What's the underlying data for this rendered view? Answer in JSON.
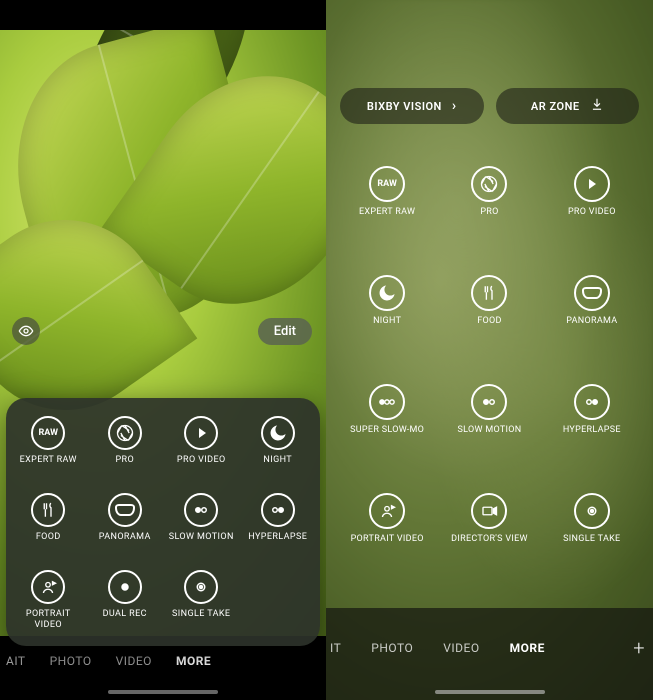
{
  "left": {
    "edit_label": "Edit",
    "modes": [
      {
        "icon": "RAW",
        "label": "EXPERT RAW"
      },
      {
        "icon": "aperture",
        "label": "PRO"
      },
      {
        "icon": "play",
        "label": "PRO VIDEO"
      },
      {
        "icon": "moon",
        "label": "NIGHT"
      },
      {
        "icon": "food",
        "label": "FOOD"
      },
      {
        "icon": "panorama",
        "label": "PANORAMA"
      },
      {
        "icon": "slowmo",
        "label": "SLOW MOTION"
      },
      {
        "icon": "hyperlapse",
        "label": "HYPERLAPSE"
      },
      {
        "icon": "portraitvid",
        "label": "PORTRAIT VIDEO"
      },
      {
        "icon": "dualrec",
        "label": "DUAL REC"
      },
      {
        "icon": "singletake",
        "label": "SINGLE TAKE"
      }
    ],
    "tabs": {
      "portrait": "AIT",
      "photo": "PHOTO",
      "video": "VIDEO",
      "more": "MORE"
    },
    "active_tab": "more"
  },
  "right": {
    "pills": {
      "bixby": "BIXBY VISION",
      "arzone": "AR ZONE"
    },
    "modes": [
      {
        "icon": "RAW",
        "label": "EXPERT RAW"
      },
      {
        "icon": "aperture",
        "label": "PRO"
      },
      {
        "icon": "play",
        "label": "PRO VIDEO"
      },
      {
        "icon": "moon",
        "label": "NIGHT"
      },
      {
        "icon": "food",
        "label": "FOOD"
      },
      {
        "icon": "panorama",
        "label": "PANORAMA"
      },
      {
        "icon": "superslow",
        "label": "SUPER SLOW-MO"
      },
      {
        "icon": "slowmo",
        "label": "SLOW MOTION"
      },
      {
        "icon": "hyperlapse",
        "label": "HYPERLAPSE"
      },
      {
        "icon": "portraitvid",
        "label": "PORTRAIT VIDEO"
      },
      {
        "icon": "director",
        "label": "DIRECTOR'S VIEW"
      },
      {
        "icon": "singletake",
        "label": "SINGLE TAKE"
      }
    ],
    "tabs": {
      "portrait": "IT",
      "photo": "PHOTO",
      "video": "VIDEO",
      "more": "MORE"
    },
    "active_tab": "more"
  }
}
